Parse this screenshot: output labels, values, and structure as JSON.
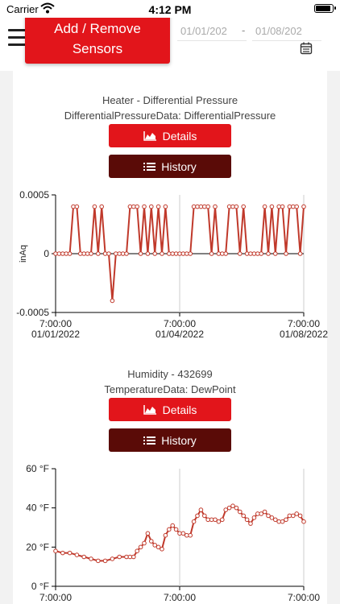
{
  "status_bar": {
    "carrier": "Carrier",
    "time": "4:12 PM"
  },
  "header": {
    "add_remove_label": "Add / Remove\nSensors",
    "date_start": "01/01/202",
    "date_end": "01/08/202",
    "date_separator": "-",
    "accent_color": "#e2151b",
    "dark_color": "#5a0b07"
  },
  "sensors": [
    {
      "name": "Heater - Differential Pressure",
      "data_type": "DifferentialPressureData: DifferentialPressure",
      "details_label": "Details",
      "history_label": "History"
    },
    {
      "name": "Humidity - 432699",
      "data_type": "TemperatureData: DewPoint",
      "details_label": "Details",
      "history_label": "History"
    }
  ],
  "chart_data": [
    {
      "type": "line",
      "ylabel": "inAq",
      "ylim": [
        -0.0005,
        0.0005
      ],
      "y_ticks": [
        "0.0005",
        "0",
        "-0.0005"
      ],
      "x_ticks": [
        {
          "time": "7:00:00",
          "date": "01/01/2022"
        },
        {
          "time": "7:00:00",
          "date": "01/04/2022"
        },
        {
          "time": "7:00:00",
          "date": "01/08/2022"
        }
      ],
      "series": [
        {
          "color": "#c0392b",
          "x": [
            0,
            0.1,
            0.2,
            0.3,
            0.4,
            0.5,
            0.6,
            0.7,
            0.8,
            0.9,
            1,
            1.1,
            1.2,
            1.3,
            1.4,
            1.5,
            1.6,
            1.7,
            1.8,
            1.9,
            2,
            2.1,
            2.2,
            2.3,
            2.4,
            2.5,
            2.6,
            2.7,
            2.8,
            2.9,
            3,
            3.1,
            3.2,
            3.3,
            3.4,
            3.5,
            3.6,
            3.7,
            3.8,
            3.9,
            4,
            4.1,
            4.2,
            4.3,
            4.4,
            4.5,
            4.6,
            4.7,
            4.8,
            4.9,
            5,
            5.1,
            5.2,
            5.3,
            5.4,
            5.5,
            5.6,
            5.7,
            5.8,
            5.9,
            6,
            6.1,
            6.2,
            6.3,
            6.4,
            6.5,
            6.6,
            6.7,
            6.8,
            6.9,
            7
          ],
          "y": [
            0,
            0,
            0,
            0,
            0,
            0.0004,
            0.0004,
            0,
            0,
            0,
            0,
            0.0004,
            0,
            0.0004,
            0,
            0,
            -0.0004,
            0,
            0,
            0,
            0,
            0.0004,
            0.0004,
            0.0004,
            0,
            0.0004,
            0,
            0.0004,
            0,
            0.0004,
            0,
            0.0004,
            0,
            0,
            0,
            0,
            0,
            0,
            0,
            0.0004,
            0.0004,
            0.0004,
            0.0004,
            0.0004,
            0,
            0.0004,
            0,
            0,
            0,
            0.0004,
            0.0004,
            0.0004,
            0,
            0.0004,
            0,
            0,
            0,
            0,
            0,
            0.0004,
            0,
            0.0004,
            0,
            0.0004,
            0.0004,
            0,
            0.0004,
            0.0004,
            0.0004,
            0,
            0.0004
          ]
        }
      ]
    },
    {
      "type": "line",
      "ylim": [
        0,
        60
      ],
      "y_ticks": [
        "60 °F",
        "40 °F",
        "20 °F",
        "0 °F"
      ],
      "x_ticks": [
        {
          "time": "7:00:00",
          "date": ""
        },
        {
          "time": "7:00:00",
          "date": ""
        },
        {
          "time": "7:00:00",
          "date": ""
        }
      ],
      "series": [
        {
          "color": "#c0392b",
          "x": [
            0,
            0.2,
            0.4,
            0.6,
            0.8,
            1,
            1.2,
            1.4,
            1.6,
            1.8,
            2,
            2.1,
            2.2,
            2.3,
            2.4,
            2.5,
            2.6,
            2.7,
            2.8,
            2.9,
            3,
            3.1,
            3.2,
            3.3,
            3.4,
            3.5,
            3.6,
            3.7,
            3.8,
            3.9,
            4,
            4.1,
            4.2,
            4.3,
            4.4,
            4.5,
            4.6,
            4.7,
            4.8,
            4.9,
            5,
            5.1,
            5.2,
            5.3,
            5.4,
            5.5,
            5.6,
            5.7,
            5.8,
            5.9,
            6,
            6.1,
            6.2,
            6.3,
            6.4,
            6.5,
            6.6,
            6.7,
            6.8,
            6.9,
            7
          ],
          "y": [
            18,
            17,
            17,
            16,
            15,
            14,
            13,
            13,
            14,
            15,
            15,
            15,
            15,
            18,
            20,
            22,
            27,
            23,
            21,
            20,
            19,
            26,
            29,
            31,
            29,
            27,
            27,
            26,
            26,
            33,
            36,
            39,
            36,
            34,
            34,
            34,
            33,
            34,
            39,
            40,
            41,
            40,
            38,
            36,
            34,
            32,
            35,
            37,
            37,
            38,
            36,
            35,
            34,
            33,
            33,
            34,
            36,
            36,
            37,
            36,
            33
          ]
        }
      ]
    }
  ]
}
